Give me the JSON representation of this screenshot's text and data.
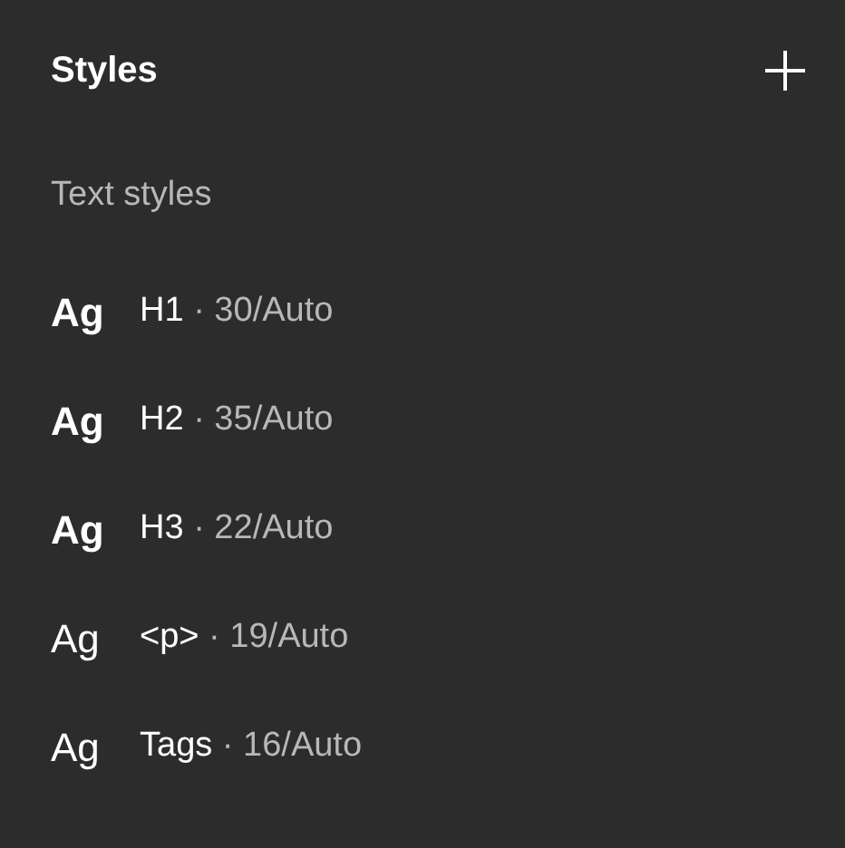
{
  "panel": {
    "title": "Styles"
  },
  "section": {
    "title": "Text styles"
  },
  "styles": [
    {
      "kind": "bold",
      "sample": "Ag",
      "name": "H1",
      "detail": "· 30/Auto"
    },
    {
      "kind": "bold",
      "sample": "Ag",
      "name": "H2",
      "detail": "· 35/Auto"
    },
    {
      "kind": "bold",
      "sample": "Ag",
      "name": "H3",
      "detail": "· 22/Auto"
    },
    {
      "kind": "regular",
      "sample": "Ag",
      "name": "<p>",
      "detail": "· 19/Auto"
    },
    {
      "kind": "regular",
      "sample": "Ag",
      "name": "Tags",
      "detail": "· 16/Auto"
    }
  ]
}
